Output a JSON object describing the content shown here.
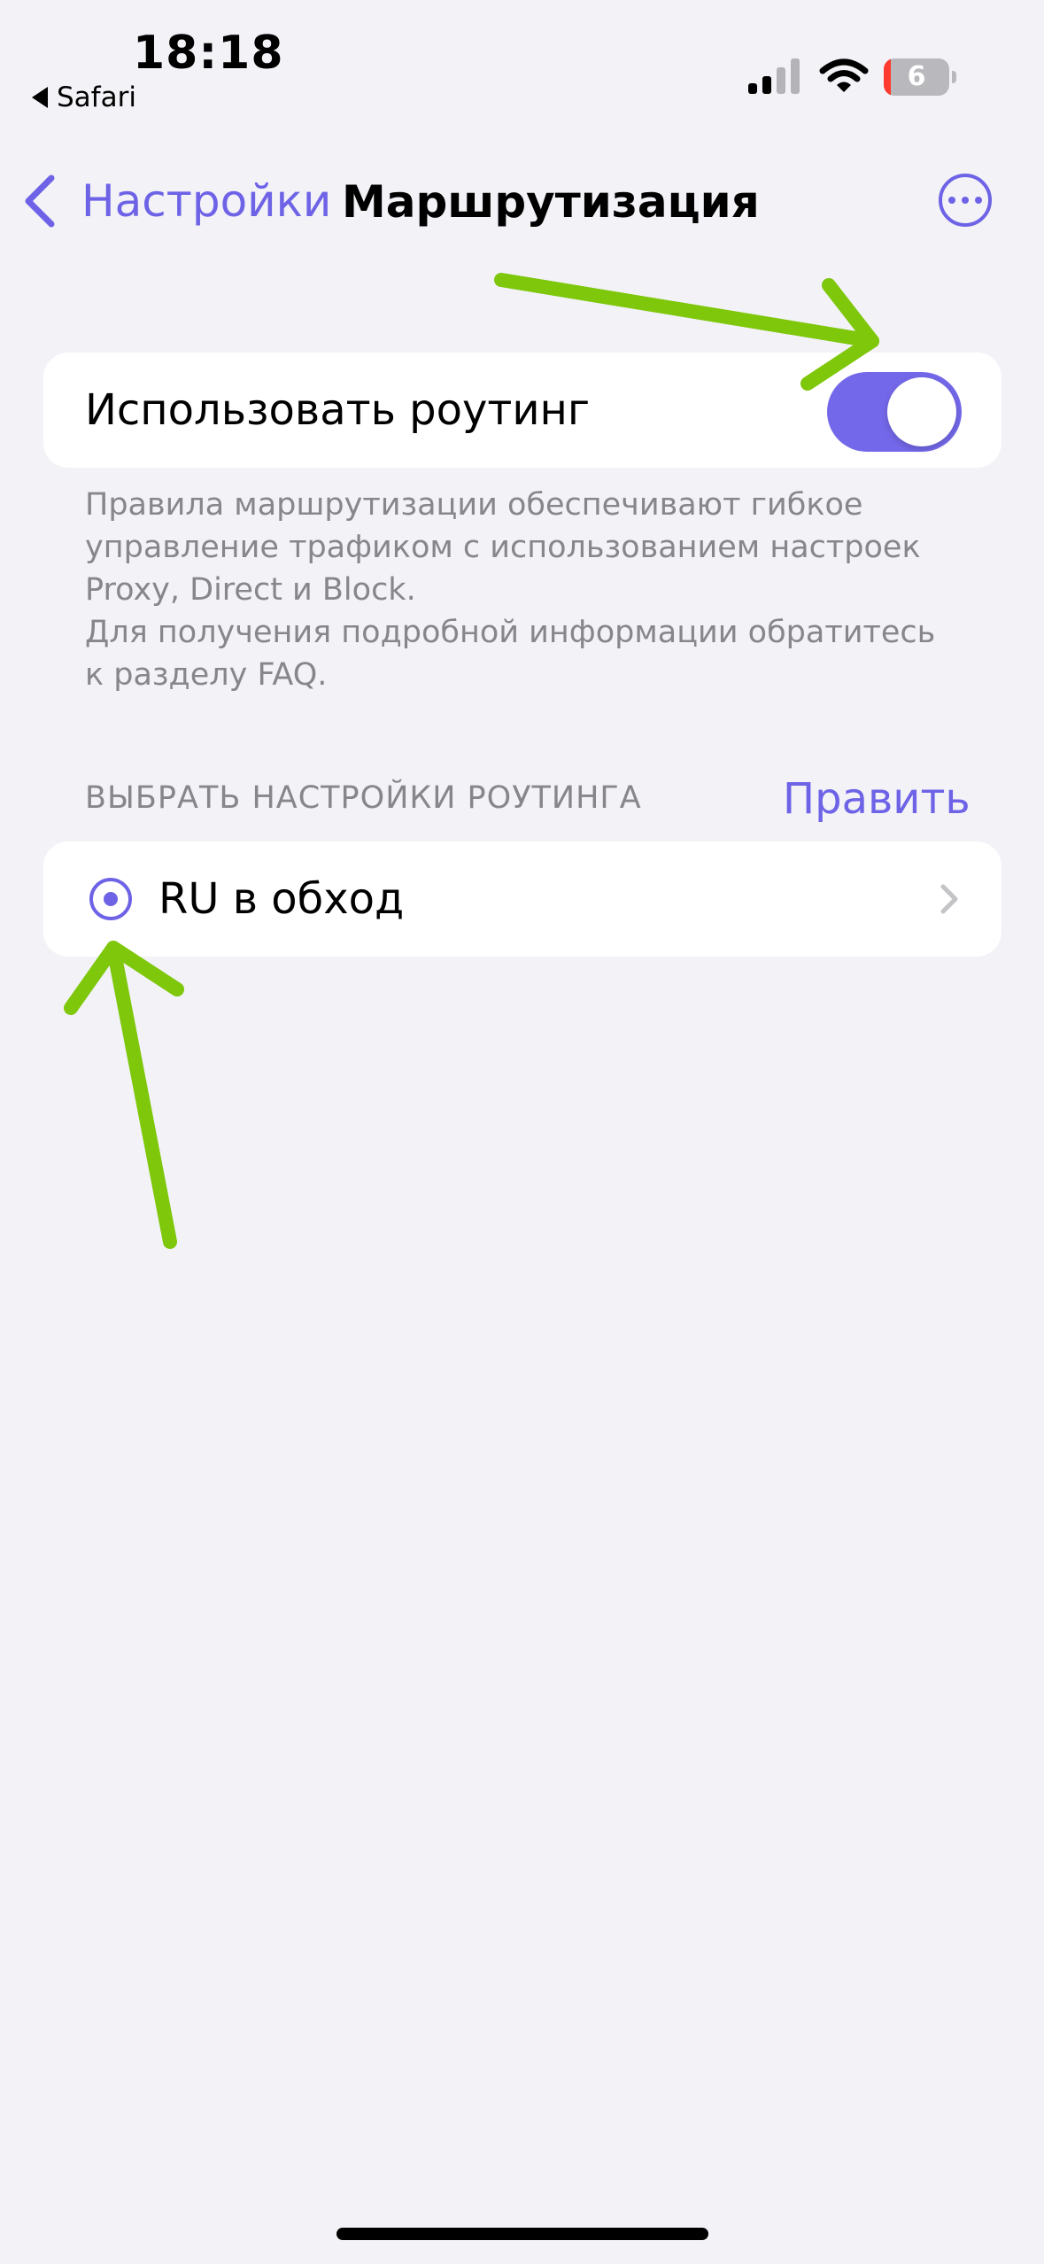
{
  "status_bar": {
    "time": "18:18",
    "back_app": "Safari",
    "battery_level": "6",
    "icons": [
      "cellular-signal-icon",
      "wifi-icon",
      "battery-icon"
    ]
  },
  "nav": {
    "back_label": "Настройки",
    "title": "Маршрутизация",
    "more_icon": "ellipsis-circle-icon"
  },
  "routing_toggle": {
    "label": "Использовать роутинг",
    "enabled": true
  },
  "routing_footer": [
    "Правила маршрутизации обеспечивают гибкое",
    "управление трафиком с использованием настроек",
    "Proxy, Direct и Block.",
    "Для получения подробной информации обратитесь",
    "к разделу FAQ."
  ],
  "routing_section": {
    "header": "ВЫБРАТЬ НАСТРОЙКИ РОУТИНГА",
    "edit_label": "Править",
    "options": [
      {
        "label": "RU в обход",
        "selected": true
      }
    ]
  },
  "colors": {
    "accent": "#6e63e6",
    "background": "#f2f2f7",
    "annotation_arrow": "#7ec70a"
  }
}
